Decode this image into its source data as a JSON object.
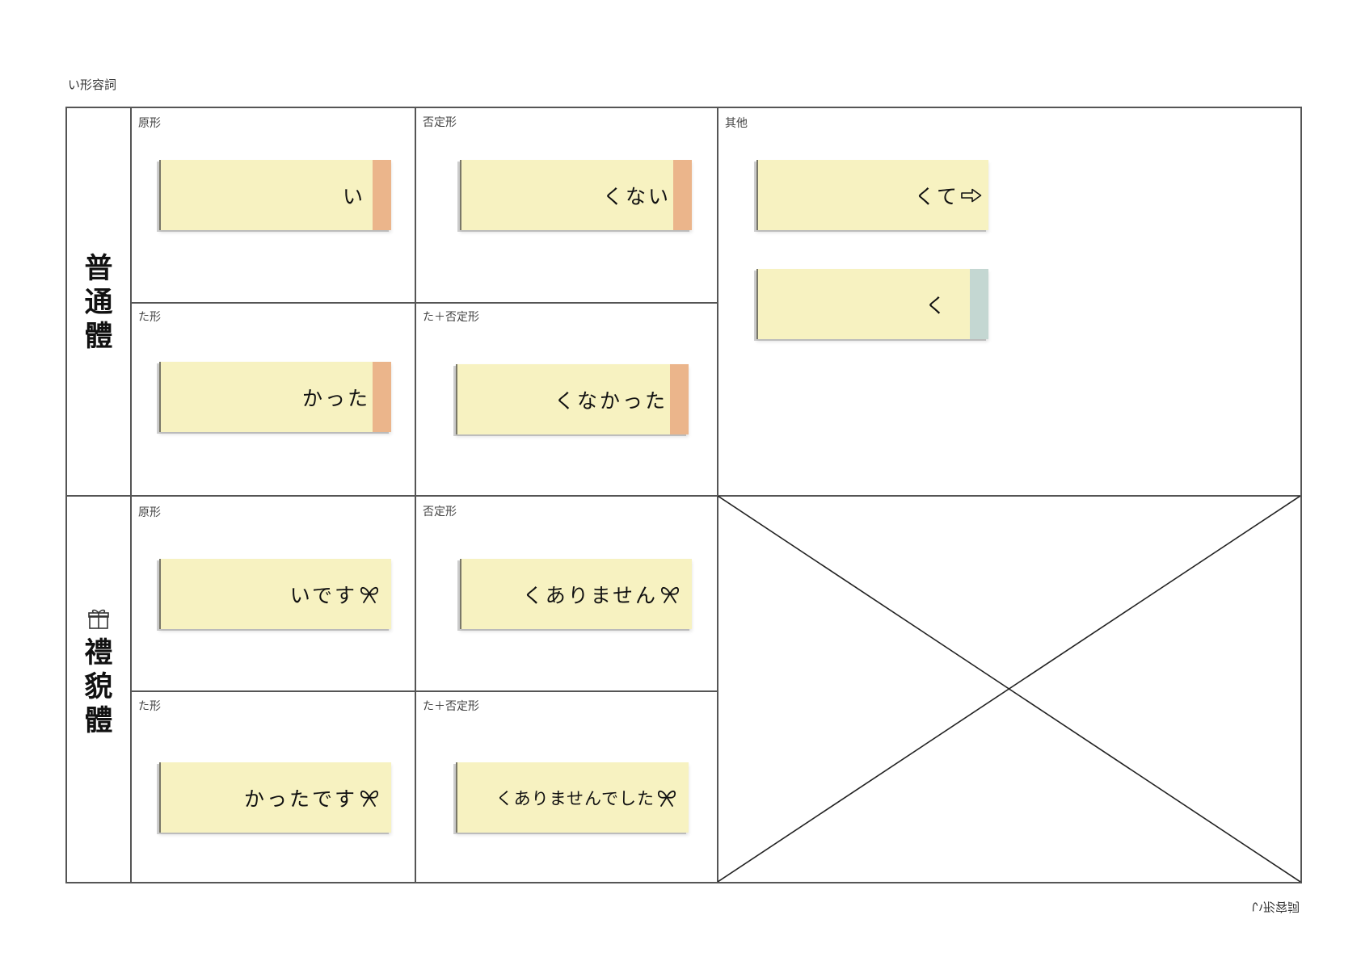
{
  "page_title": "い形容詞",
  "footer_text": "い形容詞",
  "rows": {
    "plain": {
      "label": "普通體"
    },
    "polite": {
      "label": "禮貌體",
      "icon": "gift-icon"
    }
  },
  "colors": {
    "card": "#f7f2c1",
    "tab_orange": "#ebb58b",
    "tab_teal": "#c4d7d2",
    "grid_line": "#555555"
  },
  "cells": {
    "plain_base": {
      "label": "原形",
      "card": "い",
      "tab": "orange"
    },
    "plain_negative": {
      "label": "否定形",
      "card": "くない",
      "tab": "orange"
    },
    "plain_past": {
      "label": "た形",
      "card": "かった",
      "tab": "orange"
    },
    "plain_past_negative": {
      "label": "た＋否定形",
      "card": "くなかった",
      "tab": "orange"
    },
    "plain_other": {
      "label": "其他",
      "cards": [
        {
          "text": "くて",
          "icon": "right-arrow-icon"
        },
        {
          "text": "く",
          "tab": "teal"
        }
      ]
    },
    "polite_base": {
      "label": "原形",
      "card": "いです",
      "icon": "ribbon-bow-icon"
    },
    "polite_negative": {
      "label": "否定形",
      "card": "くありません",
      "icon": "ribbon-bow-icon"
    },
    "polite_past": {
      "label": "た形",
      "card": "かったです",
      "icon": "ribbon-bow-icon"
    },
    "polite_past_negative": {
      "label": "た＋否定形",
      "card": "くありませんでした",
      "icon": "ribbon-bow-icon"
    }
  }
}
